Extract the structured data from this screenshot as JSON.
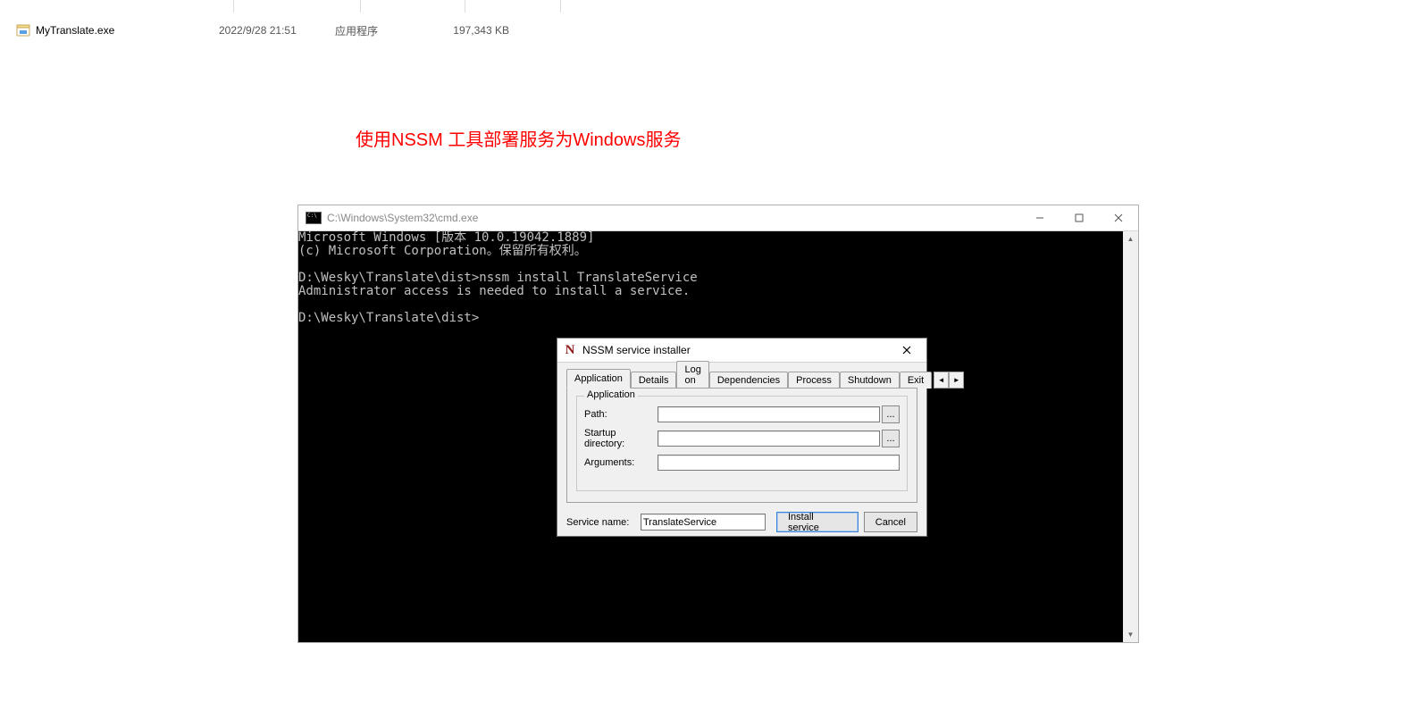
{
  "explorer": {
    "file": {
      "name": "MyTranslate.exe",
      "date": "2022/9/28 21:51",
      "type": "应用程序",
      "size": "197,343 KB"
    }
  },
  "annotation": "使用NSSM 工具部署服务为Windows服务",
  "cmd": {
    "title": "C:\\Windows\\System32\\cmd.exe",
    "content": "Microsoft Windows [版本 10.0.19042.1889]\n(c) Microsoft Corporation。保留所有权利。\n\nD:\\Wesky\\Translate\\dist>nssm install TranslateService\nAdministrator access is needed to install a service.\n\nD:\\Wesky\\Translate\\dist>"
  },
  "nssm": {
    "title": "NSSM service installer",
    "icon_text": "N",
    "tabs": {
      "application": "Application",
      "details": "Details",
      "logon": "Log on",
      "dependencies": "Dependencies",
      "process": "Process",
      "shutdown": "Shutdown",
      "exit": "Exit"
    },
    "group_label": "Application",
    "path_label": "Path:",
    "startup_label": "Startup directory:",
    "arguments_label": "Arguments:",
    "browse_label": "...",
    "service_name_label": "Service name:",
    "service_name_value": "TranslateService",
    "install_btn": "Install service",
    "cancel_btn": "Cancel",
    "spin_left": "◄",
    "spin_right": "►"
  },
  "scroll": {
    "up": "▲",
    "down": "▼"
  }
}
